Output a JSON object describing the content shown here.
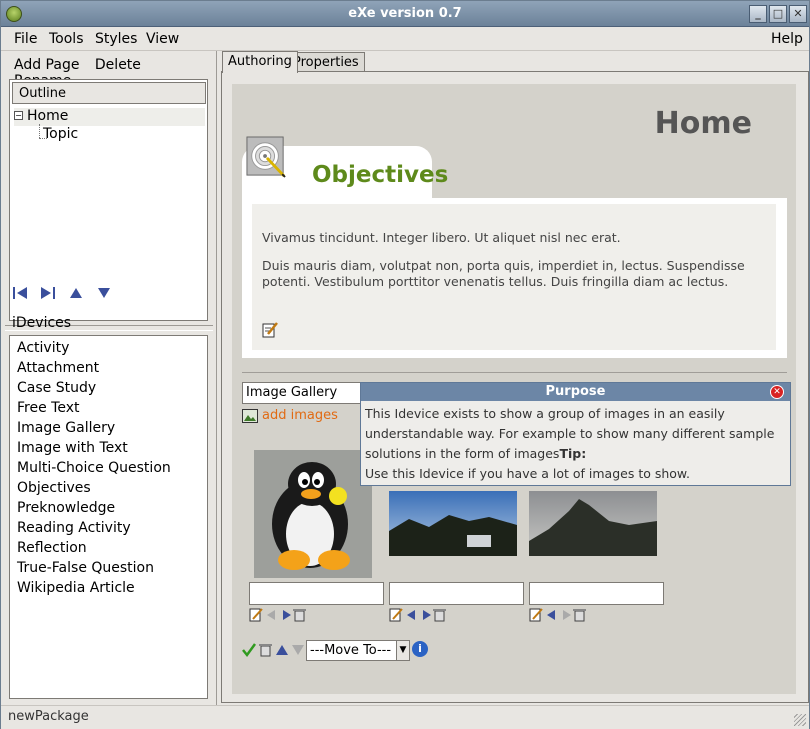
{
  "window": {
    "title": "eXe version 0.7"
  },
  "menubar": {
    "file": "File",
    "tools": "Tools",
    "styles": "Styles",
    "view": "View",
    "help": "Help"
  },
  "left": {
    "toolbar": {
      "add_page": "Add Page",
      "delete": "Delete",
      "rename": "Rename"
    },
    "outline": {
      "header": "Outline",
      "home": "Home",
      "topic": "Topic"
    },
    "idevices_header": "iDevices",
    "idevices": [
      "Activity",
      "Attachment",
      "Case Study",
      "Free Text",
      "Image Gallery",
      "Image with Text",
      "Multi-Choice Question",
      "Objectives",
      "Preknowledge",
      "Reading Activity",
      "Reflection",
      "True-False Question",
      "Wikipedia Article"
    ]
  },
  "tabs": {
    "authoring": "Authoring",
    "properties": "Properties"
  },
  "page": {
    "title": "Home",
    "objectives": {
      "title": "Objectives",
      "p1": "Vivamus tincidunt. Integer libero. Ut aliquet nisl nec erat.",
      "p2": "Duis mauris diam, volutpat non, porta quis, imperdiet in, lectus. Suspendisse potenti. Vestibulum porttitor venenatis tellus. Duis fringilla diam ac lectus."
    },
    "gallery": {
      "title_value": "Image Gallery",
      "add_images": "add images",
      "move_to": "---Move To---"
    }
  },
  "popup": {
    "title": "Purpose",
    "line1": "This Idevice exists to show a group of images in an easily",
    "line2": "understandable way. For example to show many different sample",
    "line3a": "solutions in the form of images",
    "tip_label": "Tip:",
    "line4": "Use this Idevice if you have a lot of images to show."
  },
  "status": {
    "text": "newPackage"
  }
}
